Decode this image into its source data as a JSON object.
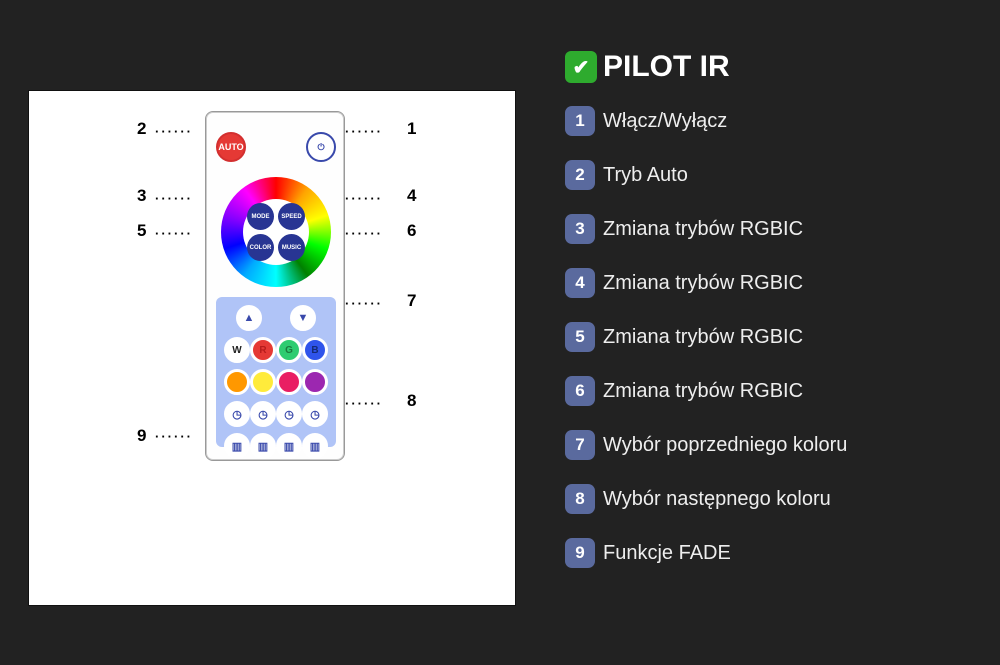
{
  "title": "PILOT IR",
  "legend": [
    {
      "n": "1",
      "t": "Włącz/Wyłącz"
    },
    {
      "n": "2",
      "t": "Tryb Auto"
    },
    {
      "n": "3",
      "t": "Zmiana trybów RGBIC"
    },
    {
      "n": "4",
      "t": "Zmiana trybów RGBIC"
    },
    {
      "n": "5",
      "t": "Zmiana trybów RGBIC"
    },
    {
      "n": "6",
      "t": "Zmiana trybów RGBIC"
    },
    {
      "n": "7",
      "t": "Wybór poprzedniego koloru"
    },
    {
      "n": "8",
      "t": "Wybór następnego koloru"
    },
    {
      "n": "9",
      "t": "Funkcje FADE"
    }
  ],
  "remote": {
    "auto_label": "AUTO",
    "power_icon": "⏻",
    "center": [
      "MODE",
      "SPEED",
      "COLOR",
      "MUSIC"
    ],
    "pad_letters": [
      "W",
      "R",
      "G",
      "B"
    ]
  },
  "callout_nums": {
    "1": "1",
    "2": "2",
    "3": "3",
    "4": "4",
    "5": "5",
    "6": "6",
    "7": "7",
    "8": "8",
    "9": "9"
  }
}
